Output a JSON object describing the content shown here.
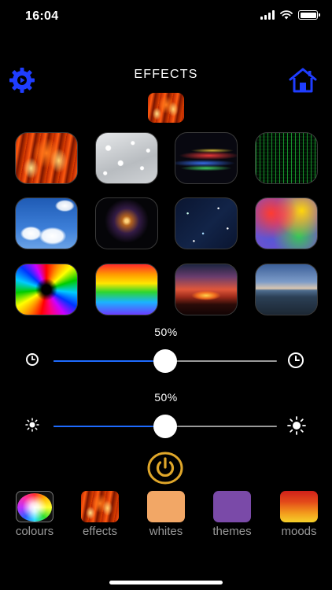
{
  "status_bar": {
    "time": "16:04"
  },
  "header": {
    "title": "EFFECTS"
  },
  "colors": {
    "accent_blue": "#1f3dff",
    "slider_blue": "#1e6bff",
    "power_gold": "#e0a72a"
  },
  "current_effect": {
    "name": "fire"
  },
  "effects": [
    {
      "name": "fire"
    },
    {
      "name": "water-drops"
    },
    {
      "name": "light-waves"
    },
    {
      "name": "matrix"
    },
    {
      "name": "blue-sky"
    },
    {
      "name": "firework"
    },
    {
      "name": "starry-night"
    },
    {
      "name": "colour-blur"
    },
    {
      "name": "rainbow-swirl"
    },
    {
      "name": "rainbow-gradient"
    },
    {
      "name": "sunset"
    },
    {
      "name": "coast"
    }
  ],
  "speed": {
    "label": "50%",
    "value": 0.5,
    "left_icon": "clock-icon",
    "right_icon": "clock-icon"
  },
  "brightness": {
    "label": "50%",
    "value": 0.5,
    "left_icon": "sun-small-icon",
    "right_icon": "sun-large-icon"
  },
  "power": {
    "icon": "power-icon"
  },
  "tabs": [
    {
      "label": "colours"
    },
    {
      "label": "effects"
    },
    {
      "label": "whites"
    },
    {
      "label": "themes"
    },
    {
      "label": "moods"
    }
  ]
}
